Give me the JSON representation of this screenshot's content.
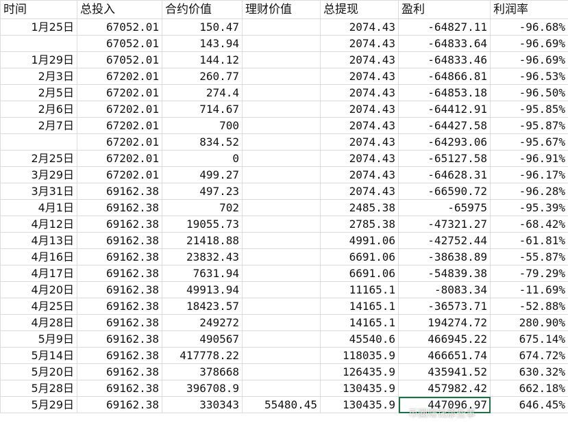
{
  "columns": [
    "时间",
    "总投入",
    "合约价值",
    "理财价值",
    "总提现",
    "盈利",
    "利润率"
  ],
  "rows": [
    [
      "1月25日",
      "67052.01",
      "150.47",
      "",
      "2074.43",
      "-64827.11",
      "-96.68%"
    ],
    [
      "",
      "67052.01",
      "143.94",
      "",
      "2074.43",
      "-64833.64",
      "-96.69%"
    ],
    [
      "1月29日",
      "67052.01",
      "144.12",
      "",
      "2074.43",
      "-64833.46",
      "-96.69%"
    ],
    [
      "2月3日",
      "67202.01",
      "260.77",
      "",
      "2074.43",
      "-64866.81",
      "-96.53%"
    ],
    [
      "2月5日",
      "67202.01",
      "274.4",
      "",
      "2074.43",
      "-64853.18",
      "-96.50%"
    ],
    [
      "2月6日",
      "67202.01",
      "714.67",
      "",
      "2074.43",
      "-64412.91",
      "-95.85%"
    ],
    [
      "2月7日",
      "67202.01",
      "700",
      "",
      "2074.43",
      "-64427.58",
      "-95.87%"
    ],
    [
      "",
      "67202.01",
      "834.52",
      "",
      "2074.43",
      "-64293.06",
      "-95.67%"
    ],
    [
      "2月25日",
      "67202.01",
      "0",
      "",
      "2074.43",
      "-65127.58",
      "-96.91%"
    ],
    [
      "3月29日",
      "67202.01",
      "499.27",
      "",
      "2074.43",
      "-64628.31",
      "-96.17%"
    ],
    [
      "3月31日",
      "69162.38",
      "497.23",
      "",
      "2074.43",
      "-66590.72",
      "-96.28%"
    ],
    [
      "4月1日",
      "69162.38",
      "702",
      "",
      "2485.38",
      "-65975",
      "-95.39%"
    ],
    [
      "4月12日",
      "69162.38",
      "19055.73",
      "",
      "2785.38",
      "-47321.27",
      "-68.42%"
    ],
    [
      "4月13日",
      "69162.38",
      "21418.88",
      "",
      "4991.06",
      "-42752.44",
      "-61.81%"
    ],
    [
      "4月16日",
      "69162.38",
      "23832.43",
      "",
      "6691.06",
      "-38638.89",
      "-55.87%"
    ],
    [
      "4月17日",
      "69162.38",
      "7631.94",
      "",
      "6691.06",
      "-54839.38",
      "-79.29%"
    ],
    [
      "4月20日",
      "69162.38",
      "49913.94",
      "",
      "11165.1",
      "-8083.34",
      "-11.69%"
    ],
    [
      "4月25日",
      "69162.38",
      "18423.57",
      "",
      "14165.1",
      "-36573.71",
      "-52.88%"
    ],
    [
      "4月28日",
      "69162.38",
      "249272",
      "",
      "14165.1",
      "194274.72",
      "280.90%"
    ],
    [
      "5月9日",
      "69162.38",
      "490567",
      "",
      "45540.6",
      "466945.22",
      "675.14%"
    ],
    [
      "5月14日",
      "69162.38",
      "417778.22",
      "",
      "118035.9",
      "466651.74",
      "674.72%"
    ],
    [
      "5月20日",
      "69162.38",
      "378668",
      "",
      "126435.9",
      "435941.52",
      "630.32%"
    ],
    [
      "5月28日",
      "69162.38",
      "396708.9",
      "",
      "130435.9",
      "457982.42",
      "662.18%"
    ],
    [
      "5月29日",
      "69162.38",
      "330343",
      "55480.45",
      "130435.9",
      "447096.97",
      "646.45%"
    ]
  ],
  "selected_cell": {
    "row": 23,
    "col": 5
  },
  "watermark": "币圈赚钱那些事",
  "colors": {
    "grid": "#dcdcdc",
    "selection": "#1e7145"
  }
}
